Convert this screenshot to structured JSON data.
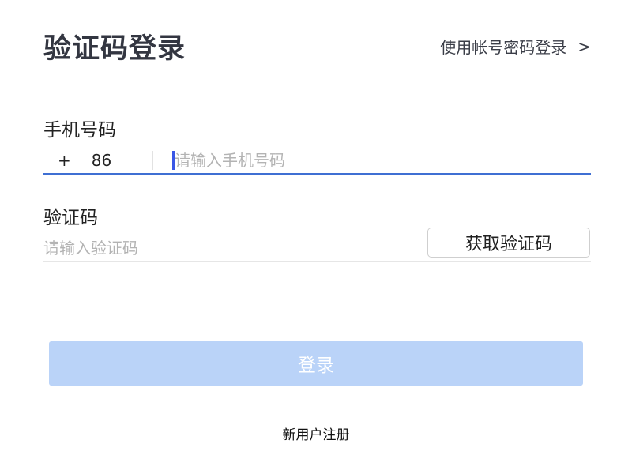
{
  "header": {
    "title": "验证码登录",
    "switch_login_label": "使用帐号密码登录",
    "switch_login_chevron": ">"
  },
  "phone": {
    "label": "手机号码",
    "country_code_plus": "+",
    "country_code_number": "86",
    "placeholder": "请输入手机号码",
    "value": ""
  },
  "verification": {
    "label": "验证码",
    "placeholder": "请输入验证码",
    "value": "",
    "get_code_label": "获取验证码"
  },
  "actions": {
    "login_label": "登录",
    "register_label": "新用户注册"
  },
  "colors": {
    "primary_disabled": "#bad3f8",
    "input_focus_underline": "#3f6fd3",
    "caret": "#3a57e6"
  }
}
